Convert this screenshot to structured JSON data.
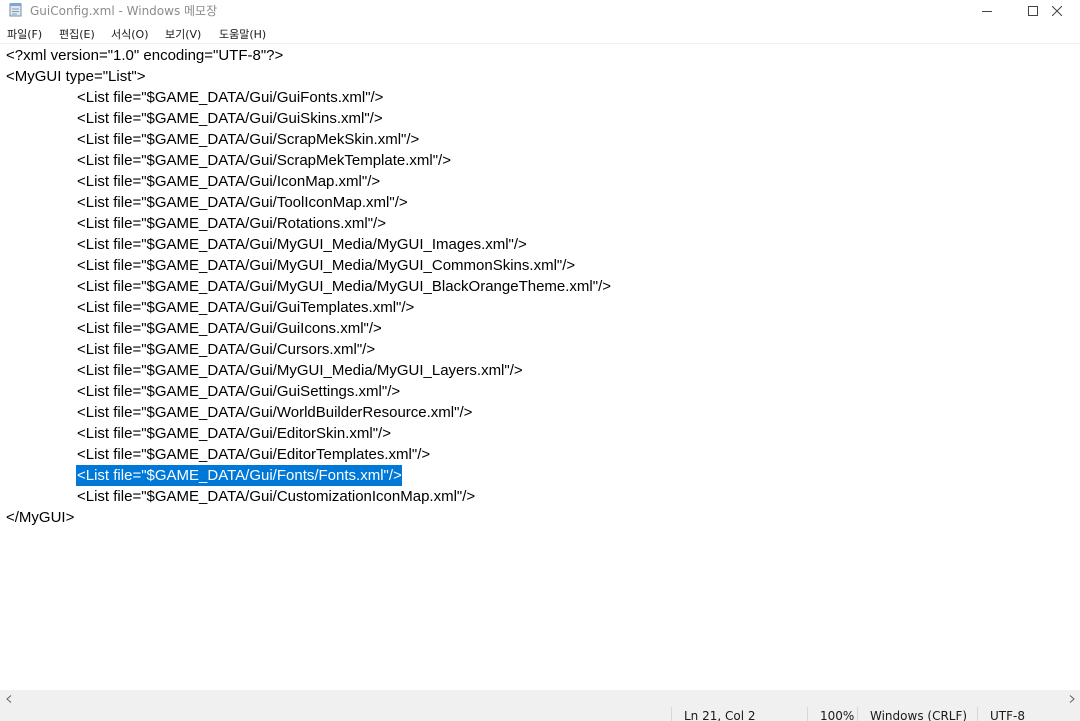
{
  "window": {
    "title": "GuiConfig.xml - Windows 메모장",
    "buttons": {
      "minimize": "minimize",
      "maximize": "maximize",
      "close": "close"
    }
  },
  "menu": {
    "items": [
      {
        "label": "파일(F)"
      },
      {
        "label": "편집(E)"
      },
      {
        "label": "서식(O)"
      },
      {
        "label": "보기(V)"
      },
      {
        "label": "도움말(H)"
      }
    ]
  },
  "document": {
    "lines": [
      "<?xml version=\"1.0\" encoding=\"UTF-8\"?>",
      "<MyGUI type=\"List\">",
      "<List file=\"$GAME_DATA/Gui/GuiFonts.xml\"/>",
      "<List file=\"$GAME_DATA/Gui/GuiSkins.xml\"/>",
      "<List file=\"$GAME_DATA/Gui/ScrapMekSkin.xml\"/>",
      "<List file=\"$GAME_DATA/Gui/ScrapMekTemplate.xml\"/>",
      "<List file=\"$GAME_DATA/Gui/IconMap.xml\"/>",
      "<List file=\"$GAME_DATA/Gui/ToolIconMap.xml\"/>",
      "<List file=\"$GAME_DATA/Gui/Rotations.xml\"/>",
      "<List file=\"$GAME_DATA/Gui/MyGUI_Media/MyGUI_Images.xml\"/>",
      "<List file=\"$GAME_DATA/Gui/MyGUI_Media/MyGUI_CommonSkins.xml\"/>",
      "<List file=\"$GAME_DATA/Gui/MyGUI_Media/MyGUI_BlackOrangeTheme.xml\"/>",
      "<List file=\"$GAME_DATA/Gui/GuiTemplates.xml\"/>",
      "<List file=\"$GAME_DATA/Gui/GuiIcons.xml\"/>",
      "<List file=\"$GAME_DATA/Gui/Cursors.xml\"/>",
      "<List file=\"$GAME_DATA/Gui/MyGUI_Media/MyGUI_Layers.xml\"/>",
      "<List file=\"$GAME_DATA/Gui/GuiSettings.xml\"/>",
      "<List file=\"$GAME_DATA/Gui/WorldBuilderResource.xml\"/>",
      "<List file=\"$GAME_DATA/Gui/EditorSkin.xml\"/>",
      "<List file=\"$GAME_DATA/Gui/EditorTemplates.xml\"/>",
      "<List file=\"$GAME_DATA/Gui/Fonts/Fonts.xml\"/>",
      "<List file=\"$GAME_DATA/Gui/CustomizationIconMap.xml\"/>",
      "</MyGUI>"
    ],
    "selected_line": 20
  },
  "status": {
    "position": "Ln 21, Col 2",
    "zoom": "100%",
    "line_ending": "Windows (CRLF)",
    "encoding": "UTF-8"
  },
  "colors": {
    "selection": "#0078d7",
    "chrome": "#f0f0f0"
  }
}
